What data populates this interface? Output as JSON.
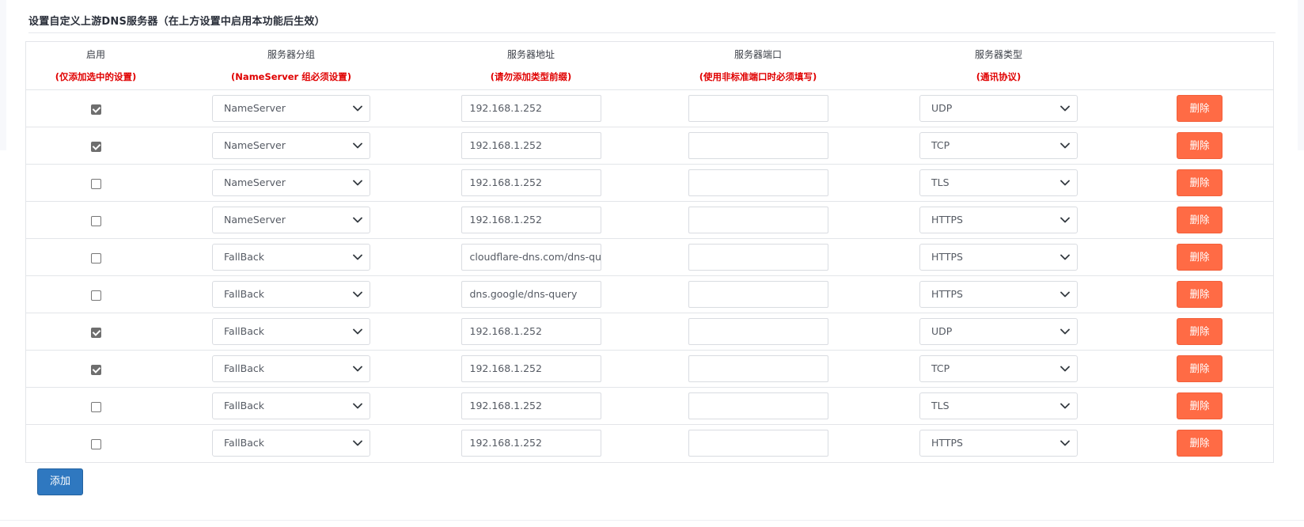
{
  "section": {
    "title": "设置自定义上游DNS服务器（在上方设置中启用本功能后生效）"
  },
  "table": {
    "headers": [
      {
        "label": "启用",
        "note": "(仅添加选中的设置)"
      },
      {
        "label": "服务器分组",
        "note": "(NameServer 组必须设置)"
      },
      {
        "label": "服务器地址",
        "note": "(请勿添加类型前缀)"
      },
      {
        "label": "服务器端口",
        "note": "(使用非标准端口时必须填写)"
      },
      {
        "label": "服务器类型",
        "note": "(通讯协议)"
      }
    ],
    "rows": [
      {
        "enabled": true,
        "group": "NameServer",
        "address": "192.168.1.252",
        "port": "",
        "type": "UDP"
      },
      {
        "enabled": true,
        "group": "NameServer",
        "address": "192.168.1.252",
        "port": "",
        "type": "TCP"
      },
      {
        "enabled": false,
        "group": "NameServer",
        "address": "192.168.1.252",
        "port": "",
        "type": "TLS"
      },
      {
        "enabled": false,
        "group": "NameServer",
        "address": "192.168.1.252",
        "port": "",
        "type": "HTTPS"
      },
      {
        "enabled": false,
        "group": "FallBack",
        "address": "cloudflare-dns.com/dns-query",
        "port": "",
        "type": "HTTPS"
      },
      {
        "enabled": false,
        "group": "FallBack",
        "address": "dns.google/dns-query",
        "port": "",
        "type": "HTTPS"
      },
      {
        "enabled": true,
        "group": "FallBack",
        "address": "192.168.1.252",
        "port": "",
        "type": "UDP"
      },
      {
        "enabled": true,
        "group": "FallBack",
        "address": "192.168.1.252",
        "port": "",
        "type": "TCP"
      },
      {
        "enabled": false,
        "group": "FallBack",
        "address": "192.168.1.252",
        "port": "",
        "type": "TLS"
      },
      {
        "enabled": false,
        "group": "FallBack",
        "address": "192.168.1.252",
        "port": "",
        "type": "HTTPS"
      }
    ],
    "delete_label": "删除"
  },
  "actions": {
    "add_label": "添加"
  },
  "icons": {
    "select_arrow": "chevron-down-icon",
    "checkbox": "checkbox-icon"
  },
  "colors": {
    "note_red": "#e00000",
    "delete_button": "#ff6b45",
    "add_button": "#2f78c0"
  }
}
